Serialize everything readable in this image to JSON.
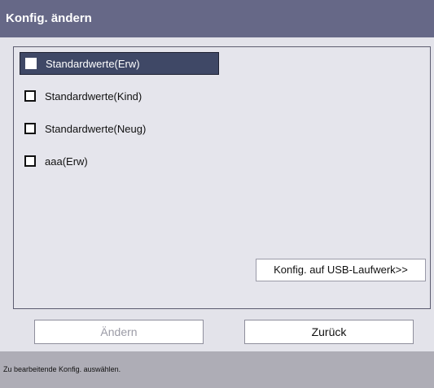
{
  "window": {
    "title": "Konfig. ändern"
  },
  "list": {
    "items": [
      {
        "label": "Standardwerte(Erw)",
        "selected": true
      },
      {
        "label": "Standardwerte(Kind)",
        "selected": false
      },
      {
        "label": "Standardwerte(Neug)",
        "selected": false
      },
      {
        "label": "aaa(Erw)",
        "selected": false
      }
    ],
    "usb_button_label": "Konfig. auf USB-Laufwerk>>"
  },
  "buttons": {
    "change_label": "Ändern",
    "back_label": "Zurück"
  },
  "status": {
    "text": "Zu bearbeitende Konfig. auswählen."
  },
  "colors": {
    "titlebar": "#666887",
    "selected_item": "#3f4866",
    "status_bar": "#aeadb6"
  }
}
